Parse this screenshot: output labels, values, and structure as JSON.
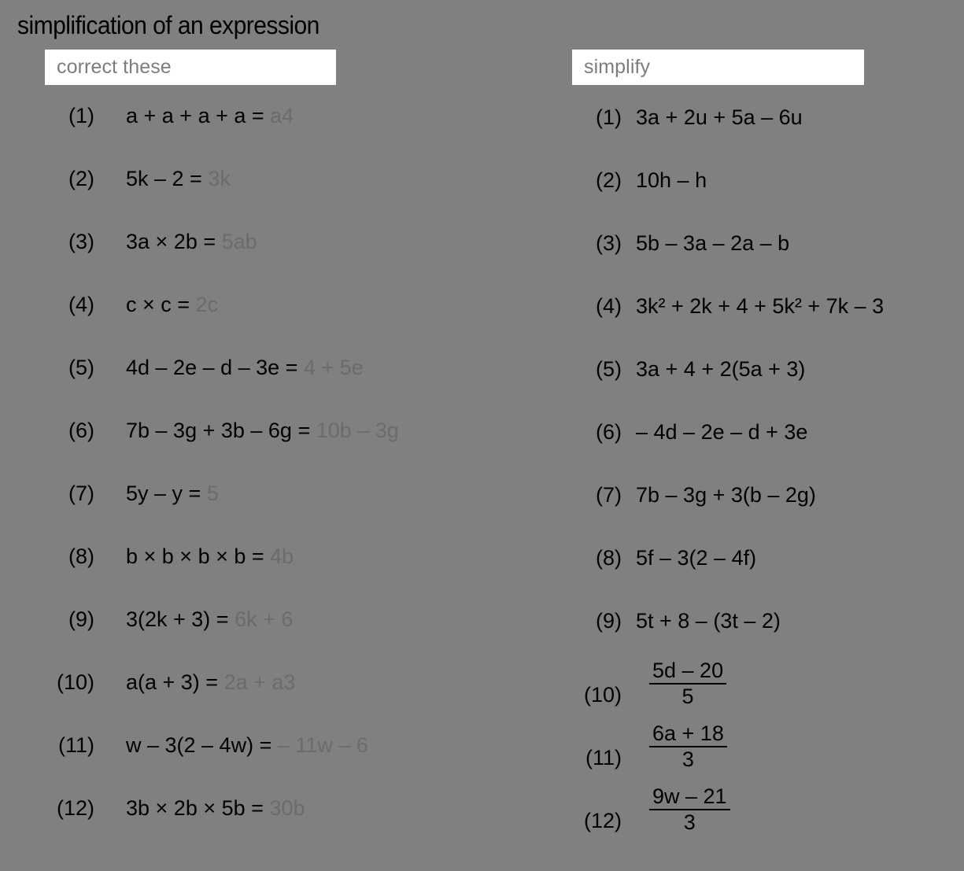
{
  "page": {
    "title": "simplification of an expression",
    "background_color": "#808080",
    "text_color": "#000000",
    "answer_color": "#6b6b6b",
    "header_box_color": "#ffffff",
    "header_text_color": "#7d7d7d"
  },
  "columns": {
    "correct": {
      "header": "correct these",
      "items": [
        {
          "num": "(1)",
          "expr": "a + a + a + a = ",
          "answer": "a4"
        },
        {
          "num": "(2)",
          "expr": "5k – 2 = ",
          "answer": "3k"
        },
        {
          "num": "(3)",
          "expr": "3a × 2b = ",
          "answer": "5ab"
        },
        {
          "num": "(4)",
          "expr": "c × c = ",
          "answer": "2c"
        },
        {
          "num": "(5)",
          "expr": "4d – 2e – d – 3e = ",
          "answer": "4 + 5e"
        },
        {
          "num": "(6)",
          "expr": "7b – 3g + 3b – 6g = ",
          "answer": "10b – 3g"
        },
        {
          "num": "(7)",
          "expr": "5y – y = ",
          "answer": "5"
        },
        {
          "num": "(8)",
          "expr": "b × b × b × b = ",
          "answer": "4b"
        },
        {
          "num": "(9)",
          "expr": "3(2k + 3) = ",
          "answer": "6k + 6"
        },
        {
          "num": "(10)",
          "expr": "a(a + 3) = ",
          "answer": "2a + a3"
        },
        {
          "num": "(11)",
          "expr": "w – 3(2 – 4w) = ",
          "answer": "– 11w – 6"
        },
        {
          "num": "(12)",
          "expr": "3b × 2b × 5b = ",
          "answer": "30b"
        }
      ]
    },
    "simplify": {
      "header": "simplify",
      "items": [
        {
          "num": "(1)",
          "expr": "3a + 2u + 5a – 6u"
        },
        {
          "num": "(2)",
          "expr": "10h – h"
        },
        {
          "num": "(3)",
          "expr": "5b – 3a – 2a – b"
        },
        {
          "num": "(4)",
          "expr": "3k² + 2k + 4 + 5k² + 7k – 3"
        },
        {
          "num": "(5)",
          "expr": "3a + 4 + 2(5a + 3)"
        },
        {
          "num": "(6)",
          "expr": "– 4d – 2e – d + 3e"
        },
        {
          "num": "(7)",
          "expr": "7b – 3g + 3(b – 2g)"
        },
        {
          "num": "(8)",
          "expr": "5f – 3(2 – 4f)"
        },
        {
          "num": "(9)",
          "expr": "5t + 8 – (3t – 2)"
        },
        {
          "num": "(10)",
          "numerator": "5d – 20",
          "denominator": "5"
        },
        {
          "num": "(11)",
          "numerator": "6a + 18",
          "denominator": "3"
        },
        {
          "num": "(12)",
          "numerator": "9w – 21",
          "denominator": "3"
        }
      ]
    }
  }
}
